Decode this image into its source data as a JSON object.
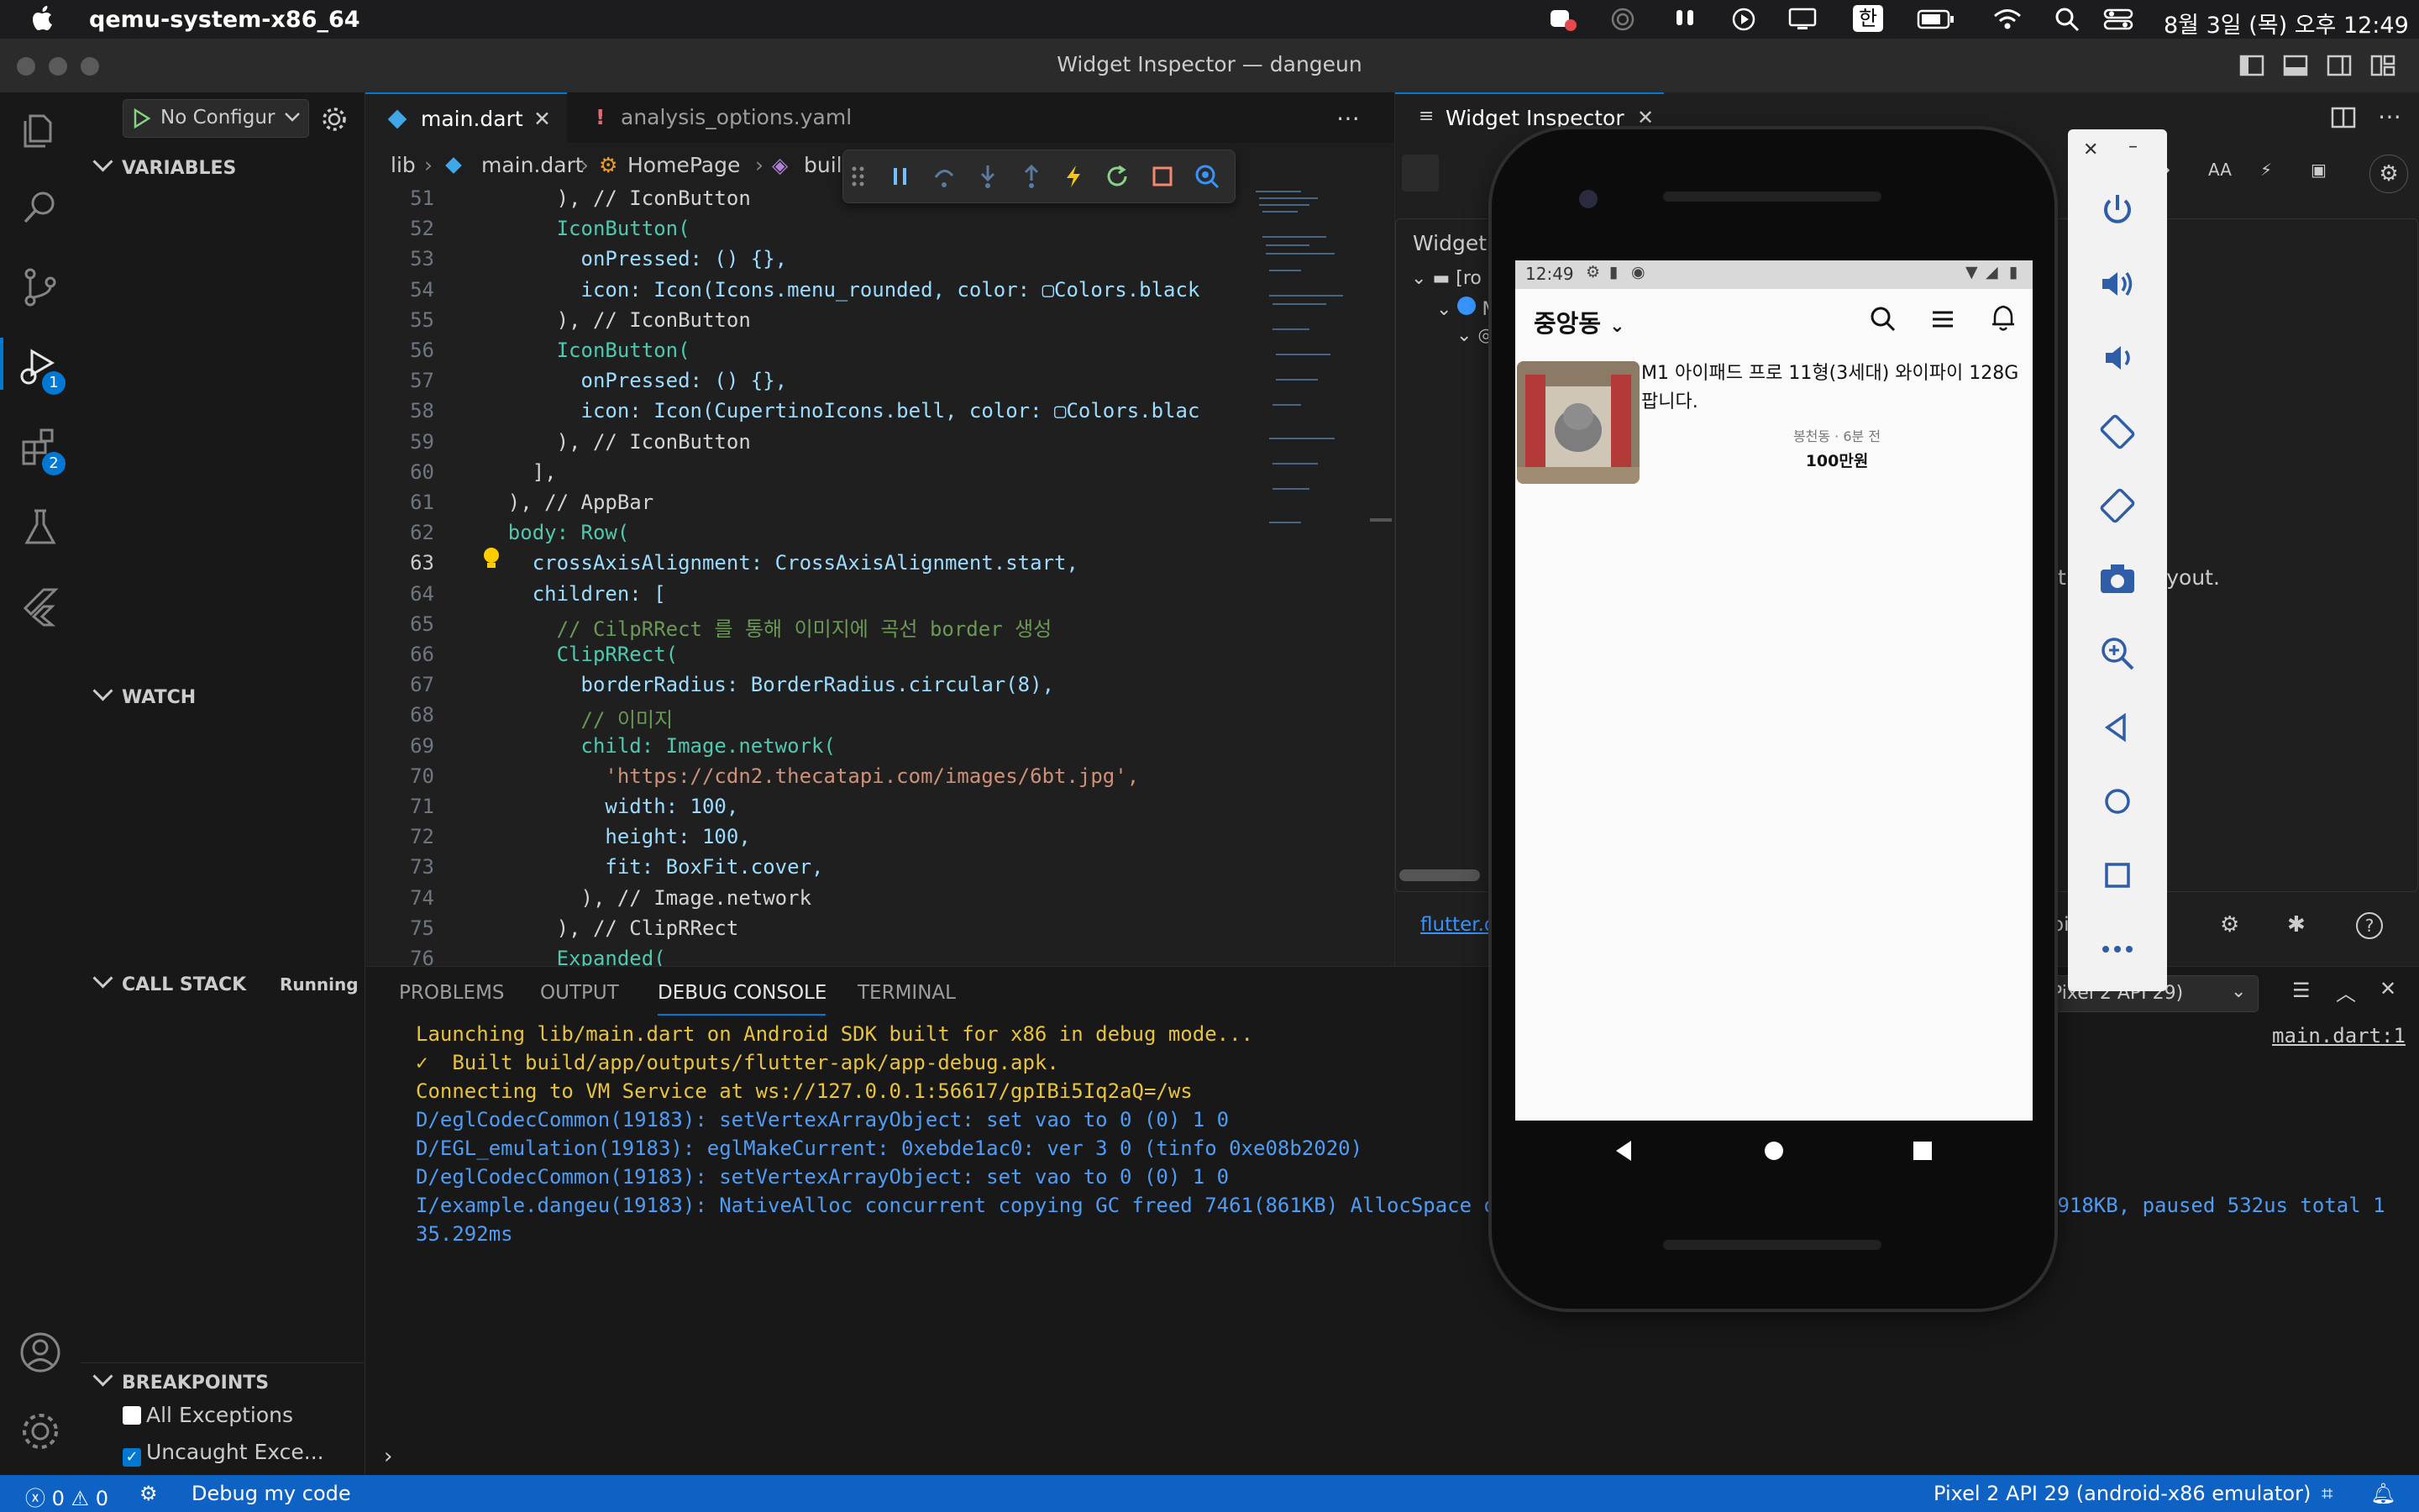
{
  "menubar": {
    "app_name": "qemu-system-x86_64",
    "input_lang": "한",
    "datetime": "8월 3일 (목) 오후 12:49"
  },
  "window": {
    "title": "Widget Inspector — dangeun"
  },
  "activity_badges": {
    "debug": "1",
    "extensions": "2"
  },
  "sidebar": {
    "run_config": "No Configur",
    "variables": "VARIABLES",
    "watch": "WATCH",
    "call_stack": "CALL STACK",
    "call_stack_status": "Running",
    "breakpoints": "BREAKPOINTS",
    "bp_items": [
      {
        "label": "All Exceptions",
        "checked": false
      },
      {
        "label": "Uncaught Exce...",
        "checked": true
      }
    ]
  },
  "editor": {
    "tabs": [
      {
        "label": "main.dart"
      },
      {
        "label": "analysis_options.yaml"
      }
    ],
    "breadcrumb": [
      "lib",
      "main.dart",
      "HomePage",
      "buil"
    ],
    "lines": [
      {
        "n": "51",
        "code": "        ), // IconButton"
      },
      {
        "n": "52",
        "code": "        IconButton("
      },
      {
        "n": "53",
        "code": "          onPressed: () {},"
      },
      {
        "n": "54",
        "code": "          icon: Icon(Icons.menu_rounded, color: ▢Colors.black"
      },
      {
        "n": "55",
        "code": "        ), // IconButton"
      },
      {
        "n": "56",
        "code": "        IconButton("
      },
      {
        "n": "57",
        "code": "          onPressed: () {},"
      },
      {
        "n": "58",
        "code": "          icon: Icon(CupertinoIcons.bell, color: ▢Colors.blac"
      },
      {
        "n": "59",
        "code": "        ), // IconButton"
      },
      {
        "n": "60",
        "code": "      ],"
      },
      {
        "n": "61",
        "code": "    ), // AppBar"
      },
      {
        "n": "62",
        "code": "    body: Row("
      },
      {
        "n": "63",
        "code": "      crossAxisAlignment: CrossAxisAlignment.start,"
      },
      {
        "n": "64",
        "code": "      children: ["
      },
      {
        "n": "65",
        "code": "        // CilpRRect 를 통해 이미지에 곡선 border 생성"
      },
      {
        "n": "66",
        "code": "        ClipRRect("
      },
      {
        "n": "67",
        "code": "          borderRadius: BorderRadius.circular(8),"
      },
      {
        "n": "68",
        "code": "          // 이미지"
      },
      {
        "n": "69",
        "code": "          child: Image.network("
      },
      {
        "n": "70",
        "code": "            'https://cdn2.thecatapi.com/images/6bt.jpg',"
      },
      {
        "n": "71",
        "code": "            width: 100,"
      },
      {
        "n": "72",
        "code": "            height: 100,"
      },
      {
        "n": "73",
        "code": "            fit: BoxFit.cover,"
      },
      {
        "n": "74",
        "code": "          ), // Image.network"
      },
      {
        "n": "75",
        "code": "        ), // ClipRRect"
      },
      {
        "n": "76",
        "code": "        Expanded("
      }
    ]
  },
  "inspector": {
    "tab_label": "Widget Inspector",
    "tree_title": "Widget",
    "tree_root": "[ro",
    "tree_m": "M",
    "details_title": "ee",
    "layout_hint_a": "t",
    "layout_hint_b": "s layout.",
    "link": "flutter.de",
    "oi": "oi"
  },
  "panel": {
    "tabs": [
      "PROBLEMS",
      "OUTPUT",
      "DEBUG CONSOLE",
      "TERMINAL"
    ],
    "device_select": "Pixel 2 API 29)",
    "source_link": "main.dart:1",
    "console": [
      "Launching lib/main.dart on Android SDK built for x86 in debug mode...",
      "✓  Built build/app/outputs/flutter-apk/app-debug.apk.",
      "Connecting to VM Service at ws://127.0.0.1:56617/gpIBi5Iq2aQ=/ws",
      "D/eglCodecCommon(19183): setVertexArrayObject: set vao to 0 (0) 1 0",
      "D/EGL_emulation(19183): eglMakeCurrent: 0xebde1ac0: ver 3 0 (tinfo 0xe08b2020)",
      "D/eglCodecCommon(19183): setVertexArrayObject: set vao to 0 (0) 1 0",
      "I/example.dangeu(19183): NativeAlloc concurrent copying GC freed 7461(861KB) AllocSpace o",
      "35.292ms"
    ],
    "console_tail": "2918KB, paused 532us total 1"
  },
  "status": {
    "errors": "0",
    "warnings": "0",
    "debug_label": "Debug my code",
    "device": "Pixel 2 API 29 (android-x86 emulator)"
  },
  "phone": {
    "time": "12:49",
    "location": "중앙동",
    "item": {
      "title": "M1 아이패드 프로 11형(3세대) 와이파이 128G 팝니다.",
      "meta": "봉천동 · 6분 전",
      "price": "100만원"
    }
  },
  "colors": {
    "accent": "#0078d4",
    "statusbar": "#0e62c3",
    "console_text": "#4f9cf5",
    "console_highlight": "#e8c33c"
  }
}
